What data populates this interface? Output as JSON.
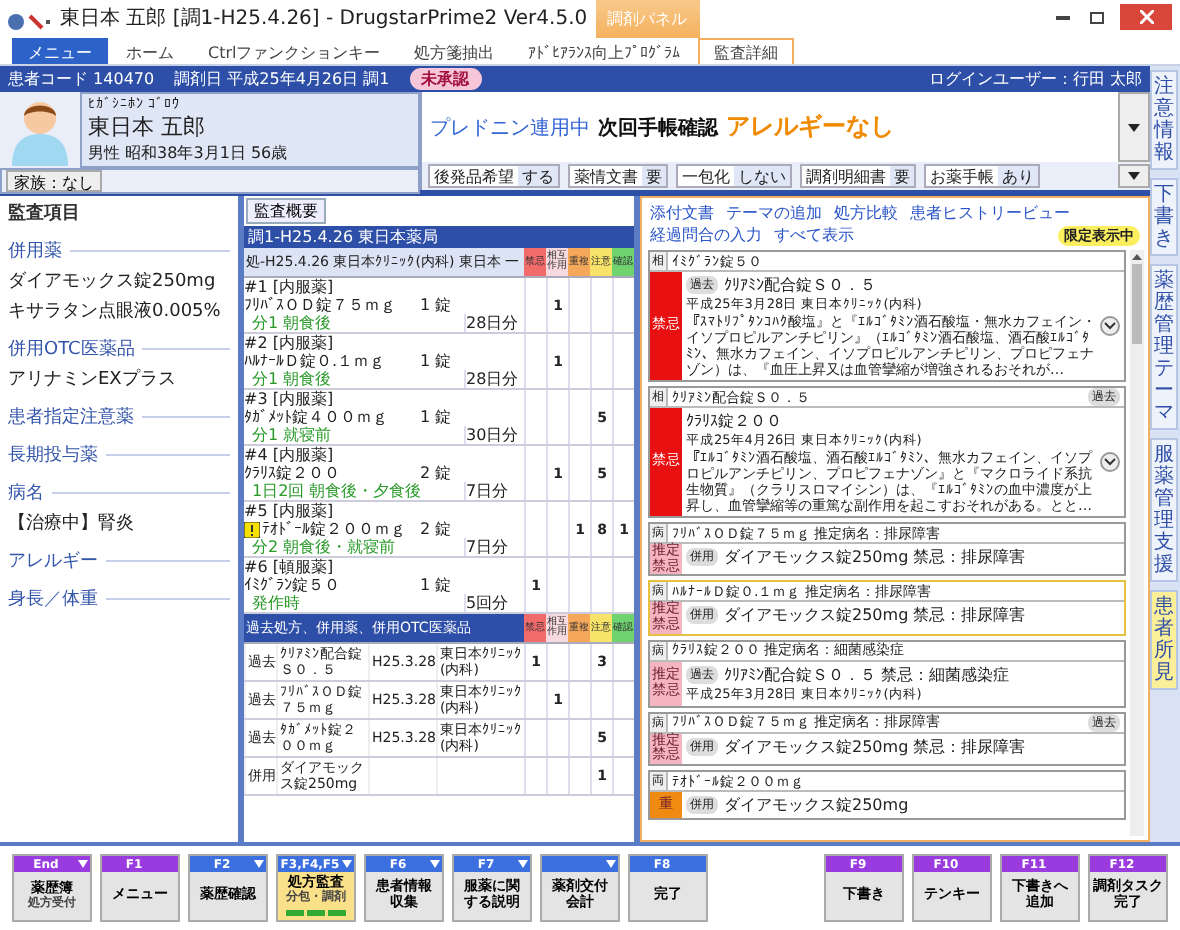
{
  "window": {
    "title": "東日本 五郎 [調1-H25.4.26] - DrugstarPrime2 Ver4.5.0",
    "context_group": "調剤パネル"
  },
  "ribbon_tabs": [
    {
      "label": "メニュー",
      "kind": "menu",
      "selected": false
    },
    {
      "label": "ホーム",
      "kind": "tab",
      "selected": false
    },
    {
      "label": "Ctrlファンクションキー",
      "kind": "tab",
      "selected": false
    },
    {
      "label": "処方箋抽出",
      "kind": "tab",
      "selected": false
    },
    {
      "label": "ｱﾄﾞﾋｱﾗﾝｽ向上ﾌﾟﾛｸﾞﾗﾑ",
      "kind": "tab",
      "selected": false
    },
    {
      "label": "監査詳細",
      "kind": "context",
      "selected": true
    }
  ],
  "info_bar": {
    "patient_code": "患者コード 140470",
    "date": "調剤日 平成25年4月26日 調1",
    "status": "未承認",
    "login": "ログインユーザー：行田 太郎"
  },
  "patient": {
    "kana": "ﾋｶﾞｼﾆﾎﾝ ｺﾞﾛｳ",
    "name": "東日本 五郎",
    "details": "男性 昭和38年3月1日 56歳",
    "family": "家族：なし"
  },
  "alerts": [
    {
      "text": "プレドニン連用中",
      "kind": "info"
    },
    {
      "text": "次回手帳確認",
      "kind": "note"
    },
    {
      "text": "アレルギーなし",
      "kind": "allergy"
    }
  ],
  "settings": [
    {
      "label": "後発品希望",
      "value": "する"
    },
    {
      "label": "薬情文書",
      "value": "要"
    },
    {
      "label": "一包化",
      "value": "しない"
    },
    {
      "label": "調剤明細書",
      "value": "要"
    },
    {
      "label": "お薬手帳",
      "value": "あり"
    }
  ],
  "side_tabs": [
    {
      "label": "注意情報",
      "selected": false
    },
    {
      "label": "下書き",
      "selected": false
    },
    {
      "label": "薬歴管理テーマ",
      "selected": false
    },
    {
      "label": "服薬管理支援",
      "selected": false
    },
    {
      "label": "患者所見",
      "selected": true
    }
  ],
  "audit_items": {
    "title": "監査項目",
    "sections": [
      {
        "title": "併用薬",
        "items": [
          "ダイアモックス錠250mg",
          "キサラタン点眼液0.005%"
        ]
      },
      {
        "title": "併用OTC医薬品",
        "items": [
          "アリナミンEXプラス"
        ]
      },
      {
        "title": "患者指定注意薬"
      },
      {
        "title": "長期投与薬"
      },
      {
        "title": "病名",
        "items": [
          "【治療中】腎炎"
        ]
      },
      {
        "title": "アレルギー"
      },
      {
        "title": "身長／体重"
      }
    ]
  },
  "overview": {
    "tab": "監査概要",
    "slip": "調1-H25.4.26 東日本薬局",
    "prescription": "処-H25.4.26 東日本ｸﾘﾆｯｸ(内科) 東日本 一",
    "check_columns": [
      {
        "kind": "contra",
        "label": "禁忌",
        "color": "#f26b6b"
      },
      {
        "kind": "interaction",
        "label": "相互作用",
        "color": "#f7d9e0"
      },
      {
        "kind": "duplicate",
        "label": "重複",
        "color": "#f5a85a"
      },
      {
        "kind": "caution",
        "label": "注意",
        "color": "#f7e36a"
      },
      {
        "kind": "confirm",
        "label": "確認",
        "color": "#6fd46f"
      }
    ],
    "drugs": [
      {
        "group": "#1 [内服薬]",
        "name": "ﾌﾘﾊﾞｽＯＤ錠７５ｍｇ",
        "qty": "1",
        "unit": "錠",
        "usage": "分1 朝食後",
        "days": "28日分",
        "checks": {
          "interaction": "1"
        },
        "warning": false
      },
      {
        "group": "#2 [内服薬]",
        "name": "ﾊﾙﾅｰﾙＤ錠０.１ｍｇ",
        "qty": "1",
        "unit": "錠",
        "usage": "分1 朝食後",
        "days": "28日分",
        "checks": {
          "interaction": "1"
        },
        "warning": false
      },
      {
        "group": "#3 [内服薬]",
        "name": "ﾀｶﾞﾒｯﾄ錠４００ｍｇ",
        "qty": "1",
        "unit": "錠",
        "usage": "分1 就寝前",
        "days": "30日分",
        "checks": {
          "caution": "5"
        },
        "warning": false
      },
      {
        "group": "#4 [内服薬]",
        "name": "ｸﾗﾘｽ錠２００",
        "qty": "2",
        "unit": "錠",
        "usage": "1日2回 朝食後・夕食後",
        "days": "7日分",
        "checks": {
          "interaction": "1",
          "caution": "5"
        },
        "warning": false
      },
      {
        "group": "#5 [内服薬]",
        "name": "ﾃｵﾄﾞｰﾙ錠２００ｍｇ",
        "qty": "2",
        "unit": "錠",
        "usage": "分2 朝食後・就寝前",
        "days": "7日分",
        "checks": {
          "duplicate": "1",
          "caution": "8",
          "confirm": "1"
        },
        "warning": true
      },
      {
        "group": "#6 [頓服薬]",
        "name": "ｲﾐｸﾞﾗﾝ錠５０",
        "qty": "1",
        "unit": "錠",
        "usage": "発作時",
        "days": "5回分",
        "checks": {
          "contra": "1"
        },
        "warning": false
      }
    ],
    "past_title": "過去処方、併用薬、併用OTC医薬品",
    "past_check_columns": [
      {
        "kind": "contra",
        "label": "禁忌",
        "color": "#f26b6b"
      },
      {
        "kind": "interaction",
        "label": "相互作用",
        "color": "#f7d9e0"
      },
      {
        "kind": "duplicate",
        "label": "重複",
        "color": "#f5a85a"
      },
      {
        "kind": "caution",
        "label": "注意",
        "color": "#f7e36a"
      },
      {
        "kind": "confirm",
        "label": "確認",
        "color": "#6fd46f"
      }
    ],
    "past": [
      {
        "type": "過去",
        "name": "ｸﾘｱﾐﾝ配合錠Ｓ０．５",
        "date": "H25.3.28",
        "clinic": "東日本ｸﾘﾆｯｸ(内科)",
        "checks": {
          "contra": "1",
          "caution": "3"
        }
      },
      {
        "type": "過去",
        "name": "ﾌﾘﾊﾞｽＯＤ錠７５ｍｇ",
        "date": "H25.3.28",
        "clinic": "東日本ｸﾘﾆｯｸ(内科)",
        "checks": {
          "interaction": "1"
        }
      },
      {
        "type": "過去",
        "name": "ﾀｶﾞﾒｯﾄ錠２００ｍｇ",
        "date": "H25.3.28",
        "clinic": "東日本ｸﾘﾆｯｸ(内科)",
        "checks": {
          "caution": "5"
        }
      },
      {
        "type": "併用",
        "name": "ダイアモックス錠250mg",
        "checks": {
          "caution": "1"
        }
      }
    ]
  },
  "checks_panel": {
    "links": [
      "添付文書",
      "テーマの追加",
      "処方比較",
      "患者ヒストリービュー",
      "経過問合の入力",
      "すべて表示"
    ],
    "filter_badge": "限定表示中",
    "cards": [
      {
        "mark": "相",
        "subject": "ｲﾐｸﾞﾗﾝ錠５０",
        "kind": "contraindication",
        "side_label": "禁忌",
        "source": "過去",
        "drug": "ｸﾘｱﾐﾝ配合錠Ｓ０．５",
        "date": "平成25年3月28日 東日本ｸﾘﾆｯｸ(内科)",
        "text": "『ｽﾏﾄﾘﾌﾟﾀﾝｺﾊｸ酸塩』と『ｴﾙｺﾞﾀﾐﾝ酒石酸塩・無水カフェイン・イソプロピルアンチピリン』（ｴﾙｺﾞﾀﾐﾝ酒石酸塩、酒石酸ｴﾙｺﾞﾀﾐﾝ、無水カフェイン、イソプロピルアンチピリン、プロピフェナゾン）は、『血圧上昇又は血管攣縮が増強されるおそれが…",
        "expandable": true,
        "selected": false
      },
      {
        "mark": "相",
        "subject": "ｸﾘｱﾐﾝ配合錠Ｓ０．５",
        "subject_badge": "過去",
        "kind": "contraindication",
        "side_label": "禁忌",
        "drug": "ｸﾗﾘｽ錠２００",
        "date": "平成25年4月26日 東日本ｸﾘﾆｯｸ(内科)",
        "text": "『ｴﾙｺﾞﾀﾐﾝ酒石酸塩、酒石酸ｴﾙｺﾞﾀﾐﾝ、無水カフェイン、イソプロピルアンチピリン、プロピフェナゾン』と『マクロライド系抗生物質』（クラリスロマイシン）は、『ｴﾙｺﾞﾀﾐﾝの血中濃度が上昇し、血管攣縮等の重篤な副作用を起こすおそれがある。とと…",
        "expandable": true,
        "selected": false
      },
      {
        "mark": "病",
        "subject": "ﾌﾘﾊﾞｽＯＤ錠７５ｍｇ 推定病名：排尿障害",
        "kind": "presumed",
        "side_label": "推定禁忌",
        "source": "併用",
        "drug": "ダイアモックス錠250mg 禁忌：排尿障害",
        "expandable": false,
        "selected": false
      },
      {
        "mark": "病",
        "subject": "ﾊﾙﾅｰﾙＤ錠０.１ｍｇ 推定病名：排尿障害",
        "kind": "presumed",
        "side_label": "推定禁忌",
        "source": "併用",
        "drug": "ダイアモックス錠250mg 禁忌：排尿障害",
        "expandable": false,
        "selected": true
      },
      {
        "mark": "病",
        "subject": "ｸﾗﾘｽ錠２００ 推定病名：細菌感染症",
        "kind": "presumed",
        "side_label": "推定禁忌",
        "source": "過去",
        "drug": "ｸﾘｱﾐﾝ配合錠Ｓ０．５ 禁忌：細菌感染症",
        "date": "平成25年3月28日 東日本ｸﾘﾆｯｸ(内科)",
        "expandable": false,
        "selected": false
      },
      {
        "mark": "病",
        "subject": "ﾌﾘﾊﾞｽＯＤ錠７５ｍｇ 推定病名：排尿障害",
        "subject_badge": "過去",
        "kind": "presumed",
        "side_label": "推定禁忌",
        "source": "併用",
        "drug": "ダイアモックス錠250mg 禁忌：排尿障害",
        "expandable": false,
        "selected": false
      },
      {
        "mark": "両",
        "subject": "ﾃｵﾄﾞｰﾙ錠２００ｍｇ",
        "kind": "duplication",
        "side_label": "重",
        "source": "併用",
        "drug": "ダイアモックス錠250mg",
        "expandable": false,
        "selected": false
      }
    ]
  },
  "function_keys_left": [
    {
      "key": "End",
      "lines": [
        "薬歴簿"
      ],
      "sub": "処方受付",
      "color": "#9a3be0",
      "menu": true,
      "selected": false
    },
    {
      "key": "F1",
      "lines": [
        "メニュー"
      ],
      "color": "#9a3be0",
      "menu": false,
      "selected": false
    },
    {
      "key": "F2",
      "lines": [
        "薬歴確認"
      ],
      "color": "#3c6fe0",
      "menu": true,
      "selected": false
    },
    {
      "key": "F3,F4,F5",
      "lines": [
        "処方監査"
      ],
      "sub": "分包・調剤",
      "color": "#3c6fe0",
      "menu": true,
      "selected": true
    },
    {
      "key": "F6",
      "lines": [
        "患者情報",
        "収集"
      ],
      "color": "#3c6fe0",
      "menu": true,
      "selected": false
    },
    {
      "key": "F7",
      "lines": [
        "服薬に関",
        "する説明"
      ],
      "color": "#3c6fe0",
      "menu": true,
      "selected": false
    },
    {
      "lines": [
        "薬剤交付",
        "会計"
      ],
      "color": "#3c6fe0",
      "menu": true,
      "selected": false
    },
    {
      "key": "F8",
      "lines": [
        "完了"
      ],
      "color": "#3c6fe0",
      "menu": false,
      "selected": false
    }
  ],
  "function_keys_right": [
    {
      "key": "F9",
      "lines": [
        "下書き"
      ],
      "color": "#9a3be0",
      "menu": false,
      "selected": false
    },
    {
      "key": "F10",
      "lines": [
        "テンキー"
      ],
      "color": "#9a3be0",
      "menu": false,
      "selected": false
    },
    {
      "key": "F11",
      "lines": [
        "下書きへ",
        "追加"
      ],
      "color": "#9a3be0",
      "menu": false,
      "selected": false
    },
    {
      "key": "F12",
      "lines": [
        "調剤タスク",
        "完了"
      ],
      "color": "#9a3be0",
      "menu": false,
      "selected": false
    }
  ]
}
